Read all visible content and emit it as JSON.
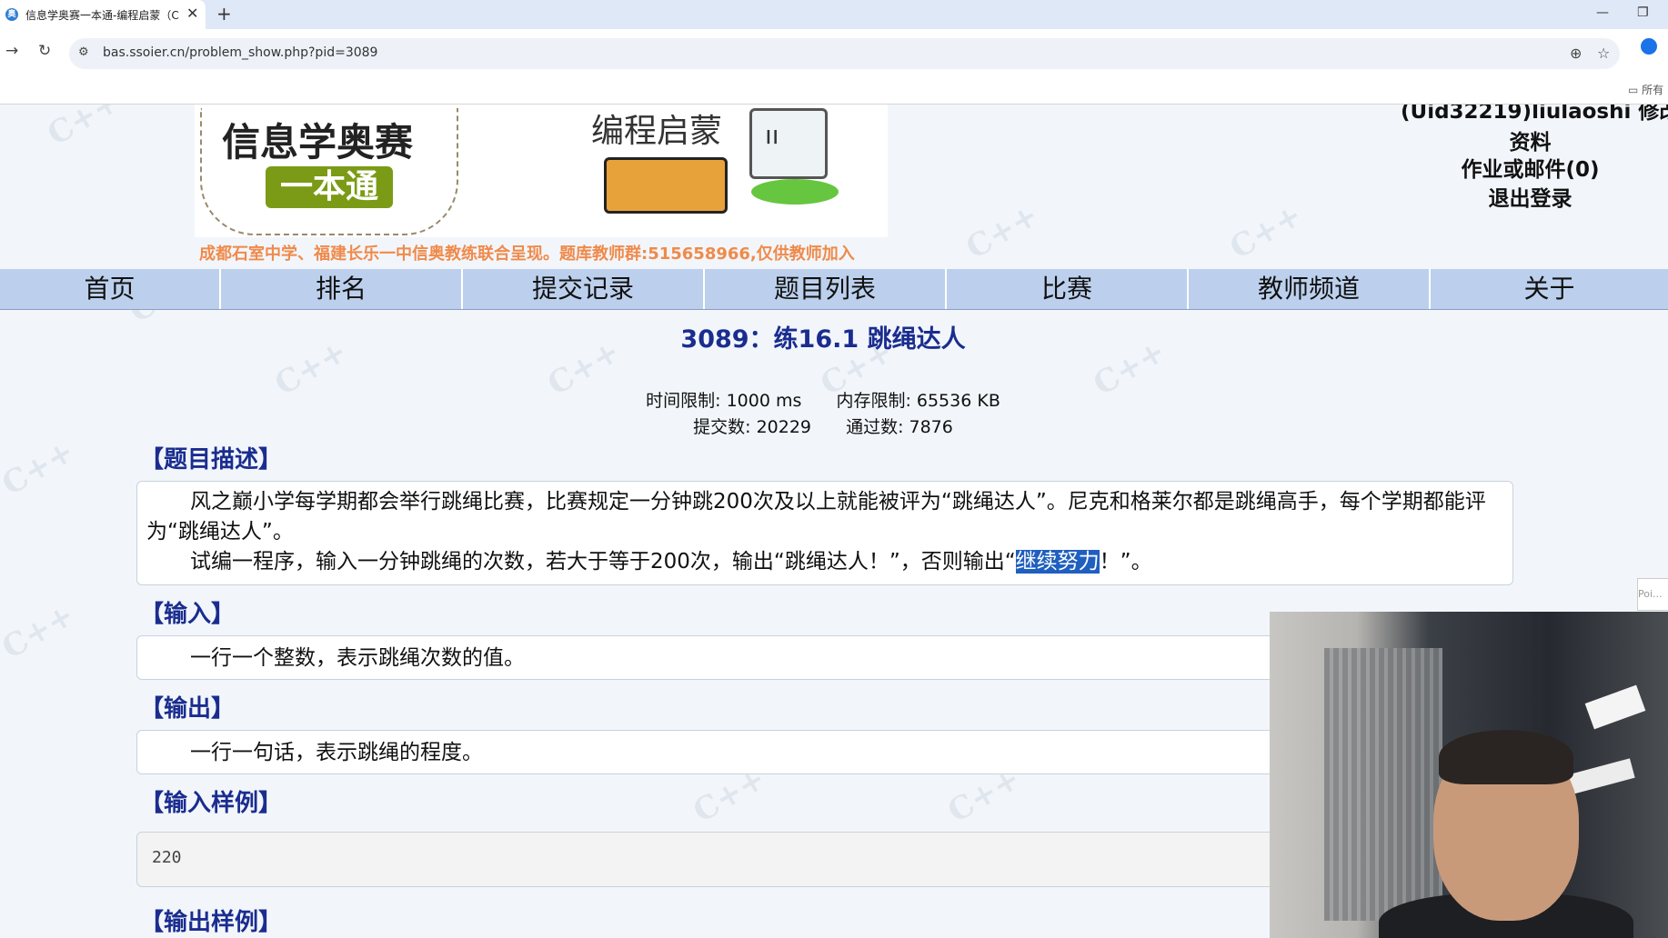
{
  "browser": {
    "tab_title": "信息学奥赛一本通-编程启蒙（C",
    "tab_close": "✕",
    "new_tab": "+",
    "url": "bas.ssoier.cn/problem_show.php?pid=3089",
    "bookmarks_label": "所有",
    "icons": [
      "back-icon",
      "reload-icon",
      "site-info-icon",
      "zoom-icon",
      "star-icon",
      "profile-icon",
      "folder-icon"
    ]
  },
  "header": {
    "logo_title": "信息学奥赛",
    "logo_sub": "一本通",
    "logo_right": "编程启蒙",
    "tagline": "成都石室中学、福建长乐一中信奥教练联合呈现。题库教师群:515658966,仅供教师加入",
    "user": {
      "name": "(Uid32219)liulaoshi",
      "edit": "修改",
      "profile": "资料",
      "homework": "作业或邮件(0)",
      "logout": "退出登录"
    }
  },
  "nav": [
    "首页",
    "排名",
    "提交记录",
    "题目列表",
    "比赛",
    "教师频道",
    "关于"
  ],
  "problem": {
    "title": "3089：练16.1 跳绳达人",
    "time_limit": "时间限制: 1000 ms",
    "memory_limit": "内存限制: 65536 KB",
    "submissions": "提交数: 20229",
    "accepted": "通过数: 7876",
    "sections": {
      "description": "【题目描述】",
      "input": "【输入】",
      "output": "【输出】",
      "sample_input": "【输入样例】",
      "sample_output": "【输出样例】"
    },
    "description_p1": "风之巅小学每学期都会举行跳绳比赛，比赛规定一分钟跳200次及以上就能被评为“跳绳达人”。尼克和格莱尔都是跳绳高手，每个学期都能评为“跳绳达人”。",
    "description_p2_before": "试编一程序，输入一分钟跳绳的次数，若大于等于200次，输出“跳绳达人！”，否则输出“",
    "description_p2_highlight": "继续努力",
    "description_p2_after": "！”。",
    "input_text": "一行一个整数，表示跳绳次数的值。",
    "output_text": "一行一句话，表示跳绳的程度。",
    "sample_input_value": "220"
  },
  "side_stub": "Poi..."
}
